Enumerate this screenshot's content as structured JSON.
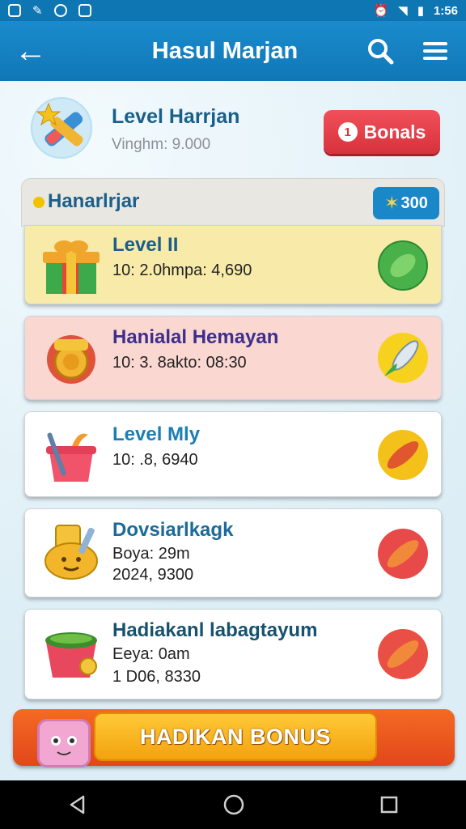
{
  "status_bar": {
    "time": "1:56"
  },
  "app_bar": {
    "title": "Hasul Marjan"
  },
  "level_header": {
    "title": "Level Harrjan",
    "subtitle": "Vinghm: 9.000",
    "bonus_badge": "1",
    "bonus_label": "Bonals"
  },
  "list_header": {
    "name": "Hanarlrjar",
    "score": "300"
  },
  "cards": [
    {
      "title": "Level II",
      "lines": [
        "10: 2.0hmpa: 4,690"
      ]
    },
    {
      "title": "Hanialal Hemayan",
      "lines": [
        "10: 3. 8akto: 08:30"
      ]
    },
    {
      "title": "Level Mly",
      "lines": [
        "10: .8, 6940"
      ]
    },
    {
      "title": "Dovsiarlkagk",
      "lines": [
        "Boya: 29m",
        "2024, 9300"
      ]
    },
    {
      "title": "Hadiakanl labagtayum",
      "lines": [
        "Eeya: 0am",
        "1 D06, 8330"
      ]
    }
  ],
  "banner": {
    "label": "HADIKAN BONUS"
  },
  "colors": {
    "primary": "#1077b6",
    "accent_red": "#d8323c",
    "banner_orange": "#e2471b",
    "banner_yellow": "#f3a20f"
  }
}
